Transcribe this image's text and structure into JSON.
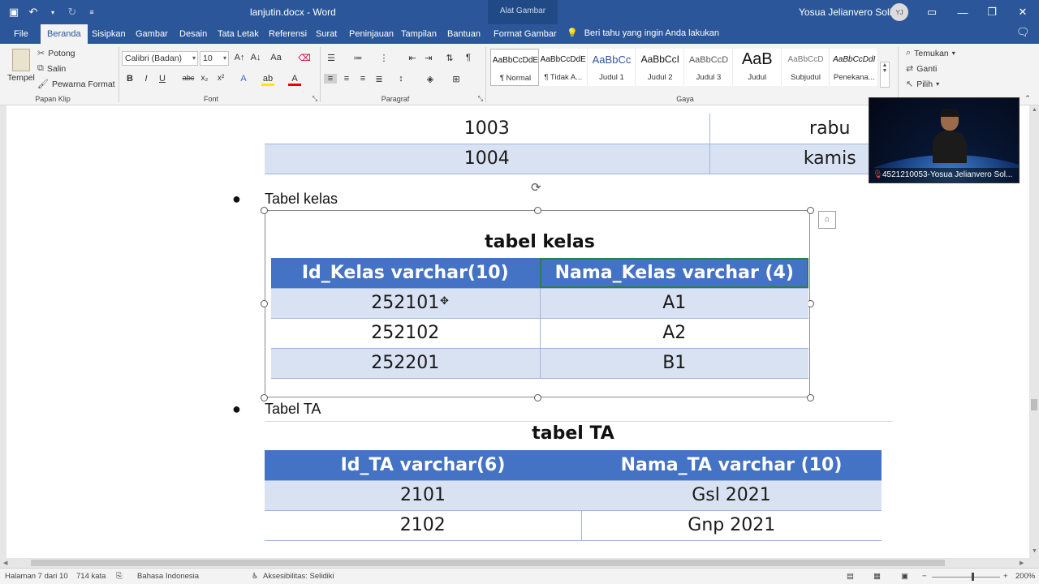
{
  "titlebar": {
    "doc_title": "lanjutin.docx  -  Word",
    "tool_context": "Alat Gambar",
    "user_name": "Yosua Jelianvero Solissa",
    "user_initials": "YJ"
  },
  "tabs": [
    "File",
    "Beranda",
    "Sisipkan",
    "Gambar",
    "Desain",
    "Tata Letak",
    "Referensi",
    "Surat",
    "Peninjauan",
    "Tampilan",
    "Bantuan",
    "Format Gambar"
  ],
  "tell_me": "Beri tahu yang ingin Anda lakukan",
  "ribbon": {
    "clipboard": {
      "paste": "Tempel",
      "cut": "Potong",
      "copy": "Salin",
      "format_painter": "Pewarna Format",
      "label": "Papan Klip"
    },
    "font": {
      "name": "Calibri (Badan)",
      "size": "10",
      "label": "Font"
    },
    "paragraph": {
      "label": "Paragraf"
    },
    "styles": {
      "label": "Gaya",
      "items": [
        {
          "sample": "AaBbCcDdE",
          "name": "¶ Normal"
        },
        {
          "sample": "AaBbCcDdE",
          "name": "¶ Tidak A..."
        },
        {
          "sample": "AaBbCc",
          "name": "Judul 1"
        },
        {
          "sample": "AaBbCcI",
          "name": "Judul 2"
        },
        {
          "sample": "AaBbCcD",
          "name": "Judul 3"
        },
        {
          "sample": "AaB",
          "name": "Judul"
        },
        {
          "sample": "AaBbCcD",
          "name": "Subjudul"
        },
        {
          "sample": "AaBbCcDdI",
          "name": "Penekana..."
        }
      ]
    },
    "editing": {
      "find": "Temukan",
      "replace": "Ganti",
      "select": "Pilih"
    }
  },
  "document": {
    "prev_table_rows": [
      {
        "id": "1003",
        "day": "rabu"
      },
      {
        "id": "1004",
        "day": "kamis"
      }
    ],
    "bullet_kelas": "Tabel kelas",
    "kelas_table": {
      "title": "tabel kelas",
      "headers": [
        "Id_Kelas varchar(10)",
        "Nama_Kelas varchar (4)"
      ],
      "rows": [
        [
          "252101",
          "A1"
        ],
        [
          "252102",
          "A2"
        ],
        [
          "252201",
          "B1"
        ]
      ]
    },
    "bullet_ta": "Tabel TA",
    "ta_table": {
      "title": "tabel TA",
      "headers": [
        "Id_TA varchar(6)",
        "Nama_TA varchar (10)"
      ],
      "rows": [
        [
          "2101",
          "Gsl 2021"
        ],
        [
          "2102",
          "Gnp 2021"
        ]
      ]
    }
  },
  "video": {
    "caption": "4521210053-Yosua Jelianvero Sol..."
  },
  "status": {
    "page": "Halaman 7 dari 10",
    "words": "714 kata",
    "language": "Bahasa Indonesia",
    "accessibility": "Aksesibilitas: Selidiki",
    "zoom": "200%"
  }
}
